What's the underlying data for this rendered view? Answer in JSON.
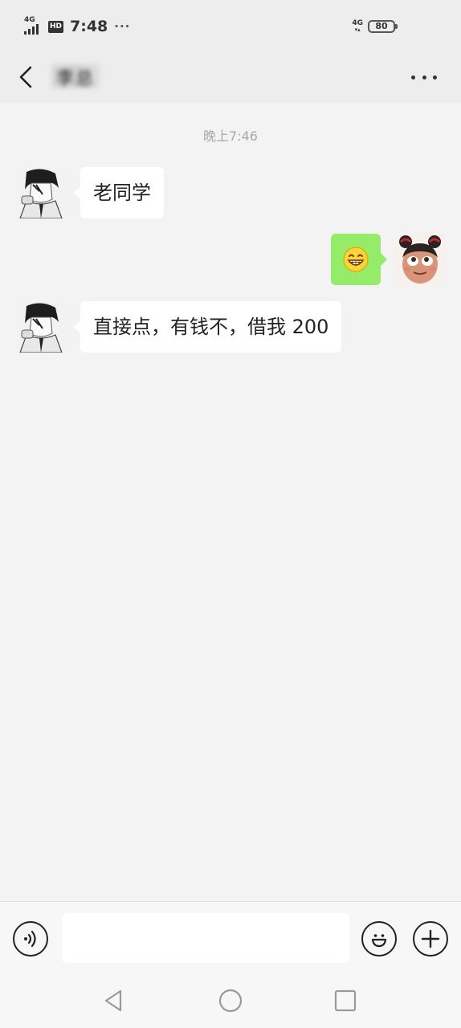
{
  "status_bar": {
    "network_left": "4G",
    "hd_label": "HD",
    "time": "7:48",
    "more_dots": "···",
    "network_right": "4G",
    "battery_level": "80"
  },
  "header": {
    "contact_name": "李总",
    "back_icon": "chevron-left-icon",
    "more_icon": "ellipsis-icon"
  },
  "chat": {
    "timestamp": "晚上7:46",
    "messages": [
      {
        "sender": "contact",
        "type": "text",
        "text": "老同学"
      },
      {
        "sender": "me",
        "type": "emoji",
        "emoji": "grinning-face-emoji"
      },
      {
        "sender": "contact",
        "type": "text",
        "text": "直接点，有钱不，借我 200"
      }
    ]
  },
  "input_bar": {
    "voice_icon": "voice-icon",
    "input_value": "",
    "emoji_icon": "smiley-icon",
    "plus_icon": "plus-icon"
  },
  "system_nav": {
    "back": "triangle-back-icon",
    "home": "circle-home-icon",
    "recents": "square-recents-icon"
  },
  "colors": {
    "page_bg": "#ededed",
    "chat_bg": "#f3f3f3",
    "my_bubble": "#95ec69",
    "their_bubble": "#ffffff",
    "timestamp_text": "#a8a8a8"
  }
}
